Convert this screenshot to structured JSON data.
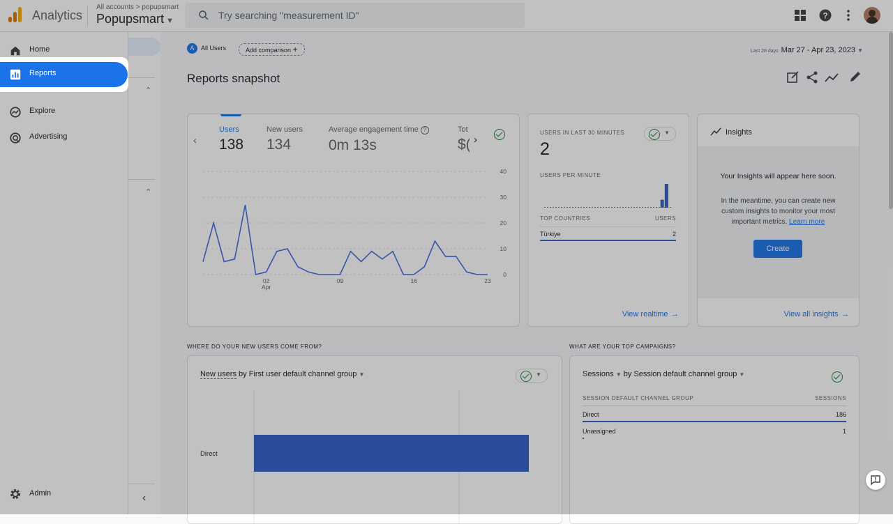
{
  "header": {
    "app_title": "Analytics",
    "breadcrumb_all": "All accounts",
    "breadcrumb_sep": ">",
    "breadcrumb_account": "popupsmart",
    "property_name": "Popupsmart",
    "search_placeholder": "Try searching \"measurement ID\"",
    "logo_colors": [
      "#f9ab00",
      "#e37400",
      "#e37400"
    ]
  },
  "nav": {
    "items": [
      {
        "label": "Home",
        "icon": "home-icon"
      },
      {
        "label": "Reports",
        "icon": "reports-icon",
        "active": true
      },
      {
        "label": "Explore",
        "icon": "explore-icon"
      },
      {
        "label": "Advertising",
        "icon": "advertising-icon"
      }
    ],
    "admin_label": "Admin"
  },
  "toolbar": {
    "segment_badge": "A",
    "segment_label": "All Users",
    "add_comparison": "Add comparison",
    "date_prefix": "Last 28 days",
    "date_range": "Mar 27 - Apr 23, 2023"
  },
  "page": {
    "title": "Reports snapshot"
  },
  "overview_card": {
    "metrics": [
      {
        "label": "Users",
        "value": "138"
      },
      {
        "label": "New users",
        "value": "134"
      },
      {
        "label": "Average engagement time",
        "value": "0m 13s"
      },
      {
        "label": "Tot",
        "value": "$("
      }
    ]
  },
  "chart_data": {
    "type": "line",
    "x_tick_labels": [
      "02\nApr",
      "09",
      "16",
      "23"
    ],
    "ylim": [
      0,
      40
    ],
    "y_ticks": [
      0,
      10,
      20,
      30,
      40
    ],
    "series": [
      {
        "values": [
          5,
          20,
          5,
          6,
          27,
          0,
          1,
          9,
          10,
          3,
          1,
          0,
          0,
          0,
          9,
          5,
          9,
          6,
          9,
          0,
          0,
          3,
          13,
          7,
          7,
          1,
          0,
          0
        ]
      }
    ],
    "color": "#4169e1"
  },
  "realtime_card": {
    "title": "USERS IN LAST 30 MINUTES",
    "value": "2",
    "per_minute_label": "USERS PER MINUTE",
    "per_minute_values": [
      0,
      0,
      0,
      0,
      0,
      0,
      0,
      0,
      0,
      0,
      0,
      0,
      0,
      0,
      0,
      0,
      0,
      0,
      0,
      0,
      0,
      0,
      0,
      0,
      0,
      0,
      0,
      1,
      3,
      0
    ],
    "countries_header": "TOP COUNTRIES",
    "users_header": "USERS",
    "countries": [
      {
        "name": "Türkiye",
        "users": "2"
      }
    ],
    "view_link": "View realtime"
  },
  "insights_card": {
    "title": "Insights",
    "headline": "Your Insights will appear here soon.",
    "body": "In the meantime, you can create new custom insights to monitor your most important metrics.",
    "learn_more": "Learn more",
    "create_button": "Create",
    "view_link": "View all insights"
  },
  "acquisition": {
    "section_title": "WHERE DO YOUR NEW USERS COME FROM?",
    "metric": "New users",
    "dimension": "by First user default channel group",
    "bar_chart": {
      "categories": [
        "Direct"
      ],
      "values": [
        134
      ],
      "color": "#2d5fc6"
    }
  },
  "campaigns": {
    "section_title": "WHAT ARE YOUR TOP CAMPAIGNS?",
    "metric": "Sessions",
    "dimension": "by Session default channel group",
    "col_dim": "SESSION DEFAULT CHANNEL GROUP",
    "col_metric": "SESSIONS",
    "rows": [
      {
        "name": "Direct",
        "value": "186"
      },
      {
        "name": "Unassigned",
        "value": "1"
      }
    ]
  }
}
